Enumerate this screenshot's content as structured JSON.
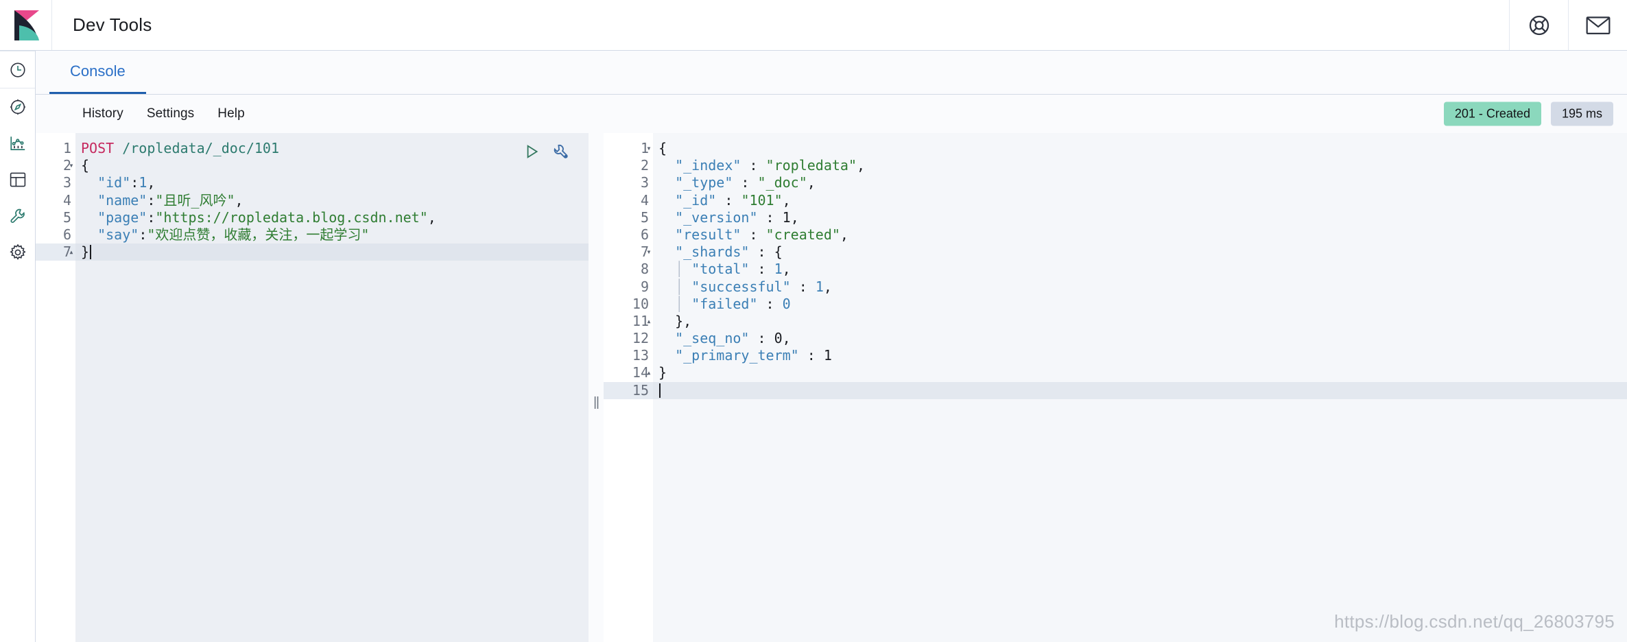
{
  "header": {
    "title": "Dev Tools",
    "logo_icon": "kibana-logo",
    "help_icon": "life-ring-icon",
    "newsfeed_icon": "envelope-icon"
  },
  "sidebar": {
    "items": [
      {
        "name": "recently-viewed",
        "icon": "clock-icon"
      },
      {
        "name": "discover",
        "icon": "compass-icon"
      },
      {
        "name": "visualize",
        "icon": "bar-chart-icon"
      },
      {
        "name": "dashboard",
        "icon": "dashboard-icon"
      },
      {
        "name": "dev-tools",
        "icon": "wrench-icon"
      },
      {
        "name": "management",
        "icon": "gear-icon"
      }
    ]
  },
  "tabs": [
    {
      "label": "Console",
      "active": true
    }
  ],
  "menu": {
    "items": [
      "History",
      "Settings",
      "Help"
    ]
  },
  "status": {
    "code_label": "201 - Created",
    "time_label": "195 ms",
    "success_color": "#8bd8bd",
    "neutral_color": "#d3dae6"
  },
  "request_editor": {
    "actions": {
      "play_icon": "play-triangle-icon",
      "wrench_icon": "wrench-icon"
    },
    "lines": [
      {
        "n": "1",
        "fold": "",
        "active": false,
        "tokens": [
          {
            "t": "POST",
            "c": "tok-method"
          },
          {
            "t": " ",
            "c": "tok-punct"
          },
          {
            "t": "/ropledata/_doc/101",
            "c": "tok-url"
          }
        ]
      },
      {
        "n": "2",
        "fold": "▾",
        "active": false,
        "tokens": [
          {
            "t": "{",
            "c": "tok-punct"
          }
        ]
      },
      {
        "n": "3",
        "fold": "",
        "active": false,
        "tokens": [
          {
            "t": "  ",
            "c": "tok-punct"
          },
          {
            "t": "\"id\"",
            "c": "tok-key"
          },
          {
            "t": ":",
            "c": "tok-punct"
          },
          {
            "t": "1",
            "c": "tok-num"
          },
          {
            "t": ",",
            "c": "tok-punct"
          }
        ]
      },
      {
        "n": "4",
        "fold": "",
        "active": false,
        "tokens": [
          {
            "t": "  ",
            "c": "tok-punct"
          },
          {
            "t": "\"name\"",
            "c": "tok-key"
          },
          {
            "t": ":",
            "c": "tok-punct"
          },
          {
            "t": "\"且听_风吟\"",
            "c": "tok-str"
          },
          {
            "t": ",",
            "c": "tok-punct"
          }
        ]
      },
      {
        "n": "5",
        "fold": "",
        "active": false,
        "tokens": [
          {
            "t": "  ",
            "c": "tok-punct"
          },
          {
            "t": "\"page\"",
            "c": "tok-key"
          },
          {
            "t": ":",
            "c": "tok-punct"
          },
          {
            "t": "\"https://ropledata.blog.csdn.net\"",
            "c": "tok-str"
          },
          {
            "t": ",",
            "c": "tok-punct"
          }
        ]
      },
      {
        "n": "6",
        "fold": "",
        "active": false,
        "tokens": [
          {
            "t": "  ",
            "c": "tok-punct"
          },
          {
            "t": "\"say\"",
            "c": "tok-key"
          },
          {
            "t": ":",
            "c": "tok-punct"
          },
          {
            "t": "\"欢迎点赞，收藏，关注，一起学习\"",
            "c": "tok-str"
          }
        ]
      },
      {
        "n": "7",
        "fold": "▴",
        "active": true,
        "caret": true,
        "tokens": [
          {
            "t": "}",
            "c": "tok-punct"
          }
        ]
      }
    ]
  },
  "response_editor": {
    "lines": [
      {
        "n": "1",
        "fold": "▾",
        "active": false,
        "tokens": [
          {
            "t": "{",
            "c": "tok-punct"
          }
        ]
      },
      {
        "n": "2",
        "fold": "",
        "active": false,
        "tokens": [
          {
            "t": "  ",
            "c": "tok-punct"
          },
          {
            "t": "\"_index\"",
            "c": "tok-key"
          },
          {
            "t": " : ",
            "c": "tok-punct"
          },
          {
            "t": "\"ropledata\"",
            "c": "tok-strval"
          },
          {
            "t": ",",
            "c": "tok-punct"
          }
        ]
      },
      {
        "n": "3",
        "fold": "",
        "active": false,
        "tokens": [
          {
            "t": "  ",
            "c": "tok-punct"
          },
          {
            "t": "\"_type\"",
            "c": "tok-key"
          },
          {
            "t": " : ",
            "c": "tok-punct"
          },
          {
            "t": "\"_doc\"",
            "c": "tok-strval"
          },
          {
            "t": ",",
            "c": "tok-punct"
          }
        ]
      },
      {
        "n": "4",
        "fold": "",
        "active": false,
        "tokens": [
          {
            "t": "  ",
            "c": "tok-punct"
          },
          {
            "t": "\"_id\"",
            "c": "tok-key"
          },
          {
            "t": " : ",
            "c": "tok-punct"
          },
          {
            "t": "\"101\"",
            "c": "tok-strval"
          },
          {
            "t": ",",
            "c": "tok-punct"
          }
        ]
      },
      {
        "n": "5",
        "fold": "",
        "active": false,
        "tokens": [
          {
            "t": "  ",
            "c": "tok-punct"
          },
          {
            "t": "\"_version\"",
            "c": "tok-key"
          },
          {
            "t": " : ",
            "c": "tok-punct"
          },
          {
            "t": "1",
            "c": "tok-numdark"
          },
          {
            "t": ",",
            "c": "tok-punct"
          }
        ]
      },
      {
        "n": "6",
        "fold": "",
        "active": false,
        "tokens": [
          {
            "t": "  ",
            "c": "tok-punct"
          },
          {
            "t": "\"result\"",
            "c": "tok-key"
          },
          {
            "t": " : ",
            "c": "tok-punct"
          },
          {
            "t": "\"created\"",
            "c": "tok-strval"
          },
          {
            "t": ",",
            "c": "tok-punct"
          }
        ]
      },
      {
        "n": "7",
        "fold": "▾",
        "active": false,
        "tokens": [
          {
            "t": "  ",
            "c": "tok-punct"
          },
          {
            "t": "\"_shards\"",
            "c": "tok-key"
          },
          {
            "t": " : ",
            "c": "tok-punct"
          },
          {
            "t": "{",
            "c": "tok-punct"
          }
        ]
      },
      {
        "n": "8",
        "fold": "",
        "active": false,
        "tokens": [
          {
            "t": "  ",
            "c": "tok-punct"
          },
          {
            "t": "│",
            "c": "indent-guide"
          },
          {
            "t": " ",
            "c": "tok-punct"
          },
          {
            "t": "\"total\"",
            "c": "tok-key"
          },
          {
            "t": " : ",
            "c": "tok-punct"
          },
          {
            "t": "1",
            "c": "tok-num"
          },
          {
            "t": ",",
            "c": "tok-punct"
          }
        ]
      },
      {
        "n": "9",
        "fold": "",
        "active": false,
        "tokens": [
          {
            "t": "  ",
            "c": "tok-punct"
          },
          {
            "t": "│",
            "c": "indent-guide"
          },
          {
            "t": " ",
            "c": "tok-punct"
          },
          {
            "t": "\"successful\"",
            "c": "tok-key"
          },
          {
            "t": " : ",
            "c": "tok-punct"
          },
          {
            "t": "1",
            "c": "tok-num"
          },
          {
            "t": ",",
            "c": "tok-punct"
          }
        ]
      },
      {
        "n": "10",
        "fold": "",
        "active": false,
        "tokens": [
          {
            "t": "  ",
            "c": "tok-punct"
          },
          {
            "t": "│",
            "c": "indent-guide"
          },
          {
            "t": " ",
            "c": "tok-punct"
          },
          {
            "t": "\"failed\"",
            "c": "tok-key"
          },
          {
            "t": " : ",
            "c": "tok-punct"
          },
          {
            "t": "0",
            "c": "tok-num"
          }
        ]
      },
      {
        "n": "11",
        "fold": "▴",
        "active": false,
        "tokens": [
          {
            "t": "  ",
            "c": "tok-punct"
          },
          {
            "t": "},",
            "c": "tok-punct"
          }
        ]
      },
      {
        "n": "12",
        "fold": "",
        "active": false,
        "tokens": [
          {
            "t": "  ",
            "c": "tok-punct"
          },
          {
            "t": "\"_seq_no\"",
            "c": "tok-key"
          },
          {
            "t": " : ",
            "c": "tok-punct"
          },
          {
            "t": "0",
            "c": "tok-numdark"
          },
          {
            "t": ",",
            "c": "tok-punct"
          }
        ]
      },
      {
        "n": "13",
        "fold": "",
        "active": false,
        "tokens": [
          {
            "t": "  ",
            "c": "tok-punct"
          },
          {
            "t": "\"_primary_term\"",
            "c": "tok-key"
          },
          {
            "t": " : ",
            "c": "tok-punct"
          },
          {
            "t": "1",
            "c": "tok-numdark"
          }
        ]
      },
      {
        "n": "14",
        "fold": "▴",
        "active": false,
        "tokens": [
          {
            "t": "}",
            "c": "tok-punct"
          }
        ]
      },
      {
        "n": "15",
        "fold": "",
        "active": true,
        "caret": true,
        "tokens": []
      }
    ]
  },
  "splitter": {
    "grip": "||"
  },
  "watermark": "https://blog.csdn.net/qq_26803795"
}
